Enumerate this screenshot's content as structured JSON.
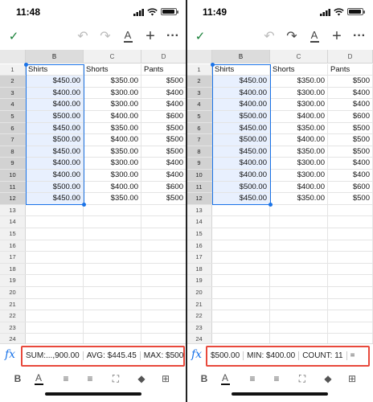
{
  "left": {
    "status": {
      "time": "11:48"
    },
    "toolbar": {
      "check": "✓",
      "undo": "↶",
      "redo": "↷",
      "format": "A",
      "add": "+",
      "more": "···"
    },
    "columns": [
      "B",
      "C",
      "D"
    ],
    "rows": [
      {
        "n": "1",
        "b": "Shirts",
        "c": "Shorts",
        "d": "Pants"
      },
      {
        "n": "2",
        "b": "$450.00",
        "c": "$350.00",
        "d": "$500"
      },
      {
        "n": "3",
        "b": "$400.00",
        "c": "$300.00",
        "d": "$400"
      },
      {
        "n": "4",
        "b": "$400.00",
        "c": "$300.00",
        "d": "$400"
      },
      {
        "n": "5",
        "b": "$500.00",
        "c": "$400.00",
        "d": "$600"
      },
      {
        "n": "6",
        "b": "$450.00",
        "c": "$350.00",
        "d": "$500"
      },
      {
        "n": "7",
        "b": "$500.00",
        "c": "$400.00",
        "d": "$500"
      },
      {
        "n": "8",
        "b": "$450.00",
        "c": "$350.00",
        "d": "$500"
      },
      {
        "n": "9",
        "b": "$400.00",
        "c": "$300.00",
        "d": "$400"
      },
      {
        "n": "10",
        "b": "$400.00",
        "c": "$300.00",
        "d": "$400"
      },
      {
        "n": "11",
        "b": "$500.00",
        "c": "$400.00",
        "d": "$600"
      },
      {
        "n": "12",
        "b": "$450.00",
        "c": "$350.00",
        "d": "$500"
      },
      {
        "n": "13",
        "b": "",
        "c": "",
        "d": ""
      },
      {
        "n": "14",
        "b": "",
        "c": "",
        "d": ""
      },
      {
        "n": "15",
        "b": "",
        "c": "",
        "d": ""
      },
      {
        "n": "16",
        "b": "",
        "c": "",
        "d": ""
      },
      {
        "n": "17",
        "b": "",
        "c": "",
        "d": ""
      },
      {
        "n": "18",
        "b": "",
        "c": "",
        "d": ""
      },
      {
        "n": "19",
        "b": "",
        "c": "",
        "d": ""
      },
      {
        "n": "20",
        "b": "",
        "c": "",
        "d": ""
      },
      {
        "n": "21",
        "b": "",
        "c": "",
        "d": ""
      },
      {
        "n": "22",
        "b": "",
        "c": "",
        "d": ""
      },
      {
        "n": "23",
        "b": "",
        "c": "",
        "d": ""
      },
      {
        "n": "24",
        "b": "",
        "c": "",
        "d": ""
      }
    ],
    "fx": "fx",
    "summary": [
      "SUM:...,900.00",
      "AVG: $445.45",
      "MAX: $500"
    ]
  },
  "right": {
    "status": {
      "time": "11:49"
    },
    "toolbar": {
      "check": "✓",
      "undo": "↶",
      "redo": "↷",
      "format": "A",
      "add": "+",
      "more": "···"
    },
    "columns": [
      "B",
      "C",
      "D"
    ],
    "rows": [
      {
        "n": "1",
        "b": "Shirts",
        "c": "Shorts",
        "d": "Pants"
      },
      {
        "n": "2",
        "b": "$450.00",
        "c": "$350.00",
        "d": "$500"
      },
      {
        "n": "3",
        "b": "$400.00",
        "c": "$300.00",
        "d": "$400"
      },
      {
        "n": "4",
        "b": "$400.00",
        "c": "$300.00",
        "d": "$400"
      },
      {
        "n": "5",
        "b": "$500.00",
        "c": "$400.00",
        "d": "$600"
      },
      {
        "n": "6",
        "b": "$450.00",
        "c": "$350.00",
        "d": "$500"
      },
      {
        "n": "7",
        "b": "$500.00",
        "c": "$400.00",
        "d": "$500"
      },
      {
        "n": "8",
        "b": "$450.00",
        "c": "$350.00",
        "d": "$500"
      },
      {
        "n": "9",
        "b": "$400.00",
        "c": "$300.00",
        "d": "$400"
      },
      {
        "n": "10",
        "b": "$400.00",
        "c": "$300.00",
        "d": "$400"
      },
      {
        "n": "11",
        "b": "$500.00",
        "c": "$400.00",
        "d": "$600"
      },
      {
        "n": "12",
        "b": "$450.00",
        "c": "$350.00",
        "d": "$500"
      },
      {
        "n": "13",
        "b": "",
        "c": "",
        "d": ""
      },
      {
        "n": "14",
        "b": "",
        "c": "",
        "d": ""
      },
      {
        "n": "15",
        "b": "",
        "c": "",
        "d": ""
      },
      {
        "n": "16",
        "b": "",
        "c": "",
        "d": ""
      },
      {
        "n": "17",
        "b": "",
        "c": "",
        "d": ""
      },
      {
        "n": "18",
        "b": "",
        "c": "",
        "d": ""
      },
      {
        "n": "19",
        "b": "",
        "c": "",
        "d": ""
      },
      {
        "n": "20",
        "b": "",
        "c": "",
        "d": ""
      },
      {
        "n": "21",
        "b": "",
        "c": "",
        "d": ""
      },
      {
        "n": "22",
        "b": "",
        "c": "",
        "d": ""
      },
      {
        "n": "23",
        "b": "",
        "c": "",
        "d": ""
      },
      {
        "n": "24",
        "b": "",
        "c": "",
        "d": ""
      }
    ],
    "fx": "fx",
    "summary": [
      "$500.00",
      "MIN: $400.00",
      "COUNT: 11",
      "="
    ]
  },
  "bottom_toolbar": {
    "bold": "B",
    "text_color": "A",
    "align_left": "≡",
    "align_center": "≡",
    "merge": "⛶",
    "fill": "◆",
    "borders": "⊞"
  },
  "colors": {
    "accent": "#1a73e8",
    "highlight": "#e8493c",
    "check": "#188038"
  }
}
